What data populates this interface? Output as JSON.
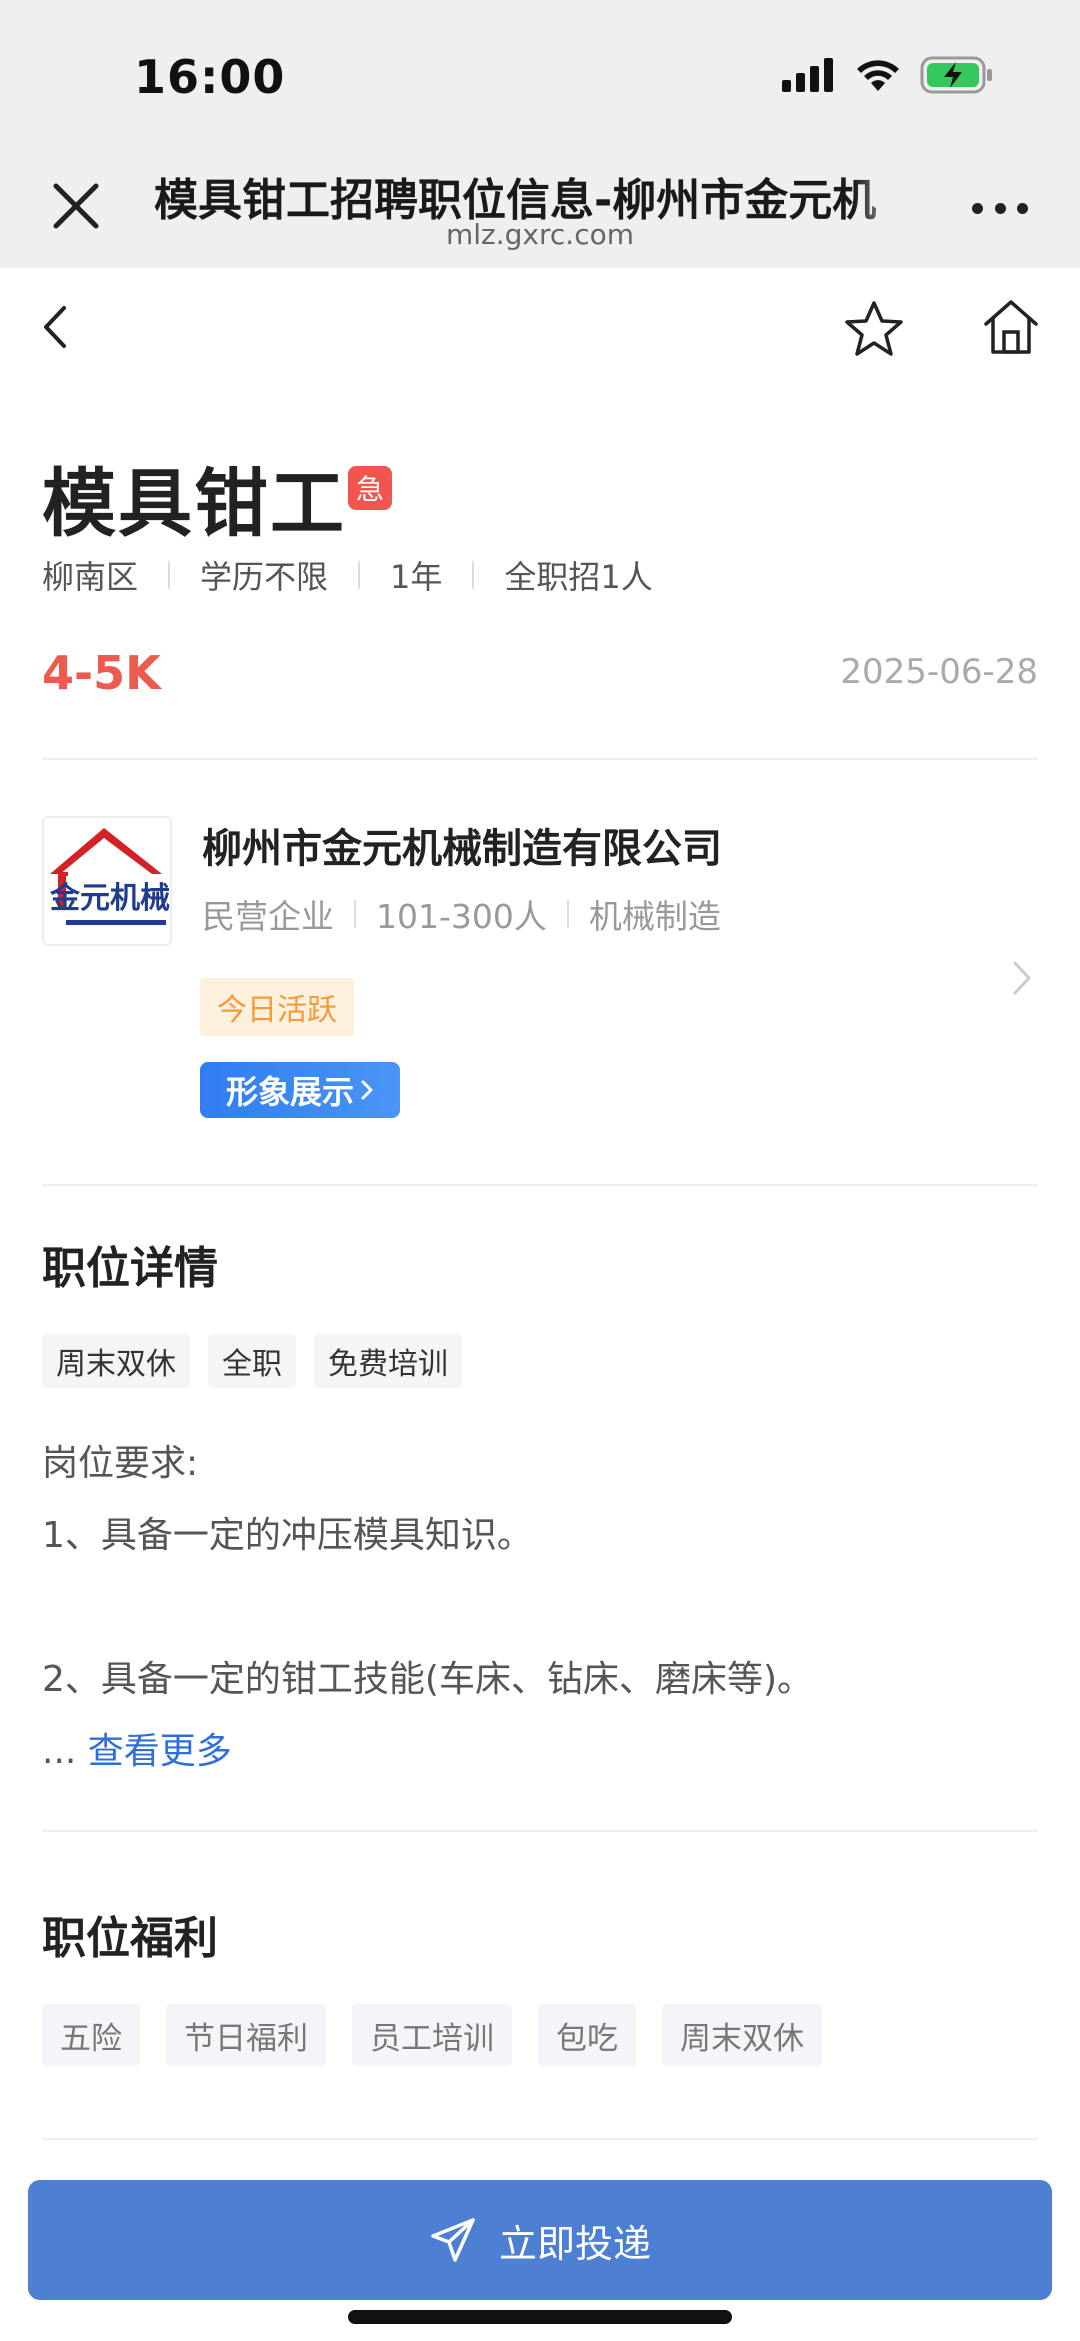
{
  "status_bar": {
    "time": "16:00"
  },
  "browser": {
    "title": "模具钳工招聘职位信息-柳州市金元机",
    "url": "mlz.gxrc.com"
  },
  "job": {
    "title": "模具钳工",
    "urgent_label": "急",
    "meta": [
      "柳南区",
      "学历不限",
      "1年",
      "全职招1人"
    ],
    "salary": "4-5K",
    "date": "2025-06-28"
  },
  "company": {
    "logo_text": "金元机械",
    "name": "柳州市金元机械制造有限公司",
    "meta": [
      "民营企业",
      "101-300人",
      "机械制造"
    ],
    "active_badge": "今日活跃",
    "showcase_label": "形象展示"
  },
  "details": {
    "title": "职位详情",
    "tags": [
      "周末双休",
      "全职",
      "免费培训"
    ],
    "lines": [
      "岗位要求:",
      "1、具备一定的冲压模具知识。",
      "",
      "2、具备一定的钳工技能(车床、钻床、磨床等)。"
    ],
    "ellipsis": "...",
    "more_label": "查看更多"
  },
  "benefits": {
    "title": "职位福利",
    "tags": [
      "五险",
      "节日福利",
      "员工培训",
      "包吃",
      "周末双休"
    ]
  },
  "apply": {
    "label": "立即投递"
  },
  "colors": {
    "accent": "#4d7fd2",
    "salary": "#ef5a4f",
    "urgent": "#f2544f",
    "active": "#f19a3e"
  }
}
